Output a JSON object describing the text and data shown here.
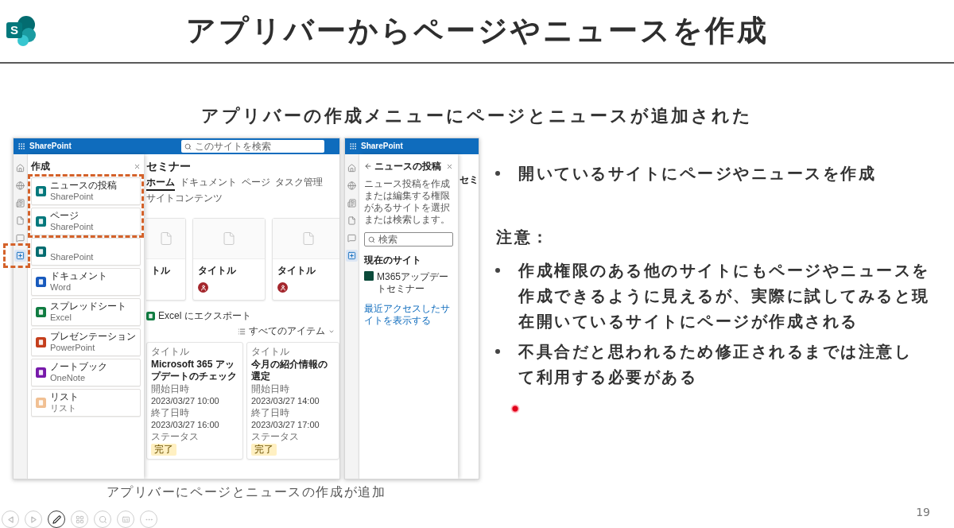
{
  "logo": {
    "letter": "S"
  },
  "title": "アプリバーからページやニュースを作成",
  "subtitle": "アプリバーの作成メニューにページとニュースが追加された",
  "screenshot_main": {
    "app_name": "SharePoint",
    "search_placeholder": "このサイトを検索",
    "rail": [
      {
        "kind": "home",
        "selected": false
      },
      {
        "kind": "sites",
        "selected": false
      },
      {
        "kind": "news",
        "selected": false
      },
      {
        "kind": "files",
        "selected": false
      },
      {
        "kind": "chat",
        "selected": false
      },
      {
        "kind": "create",
        "selected": true
      }
    ],
    "create_panel": {
      "title": "作成",
      "items": [
        {
          "kind": "news",
          "title": "ニュースの投稿",
          "subtitle": "SharePoint"
        },
        {
          "kind": "page",
          "title": "ページ",
          "subtitle": "SharePoint"
        },
        {
          "kind": "site",
          "subtitle": "SharePoint"
        },
        {
          "kind": "word",
          "title": "ドキュメント",
          "subtitle": "Word"
        },
        {
          "kind": "excel",
          "title": "スプレッドシート",
          "subtitle": "Excel"
        },
        {
          "kind": "powerpoint",
          "title": "プレゼンテーション",
          "subtitle": "PowerPoint"
        },
        {
          "kind": "onenote",
          "title": "ノートブック",
          "subtitle": "OneNote"
        },
        {
          "kind": "list",
          "title": "リスト",
          "subtitle": "リスト"
        }
      ]
    },
    "site_title": "セミナー",
    "nav": [
      {
        "label": "ホーム",
        "selected": true
      },
      {
        "label": "ドキュメント",
        "selected": false
      },
      {
        "label": "ページ",
        "selected": false
      },
      {
        "label": "タスク管理",
        "selected": false
      },
      {
        "label": "サイトコンテンツ",
        "selected": false
      }
    ],
    "cards": [
      {
        "kind": "clipped",
        "title": "トル"
      },
      {
        "kind": "full",
        "title": "タイトル"
      },
      {
        "kind": "full",
        "title": "タイトル"
      }
    ],
    "list_toolbar": {
      "export": "Excel にエクスポート",
      "view": "すべてのアイテム"
    },
    "list_items": [
      {
        "label": "タイトル",
        "title": "Microsoft 365 アップデートのチェック",
        "start_label": "開始日時",
        "start": "2023/03/27 10:00",
        "end_label": "終了日時",
        "end": "2023/03/27 16:00",
        "status_label": "ステータス",
        "status": "完了"
      },
      {
        "label": "タイトル",
        "title": "今月の紹介情報の選定",
        "start_label": "開始日時",
        "start": "2023/03/27 14:00",
        "end_label": "終了日時",
        "end": "2023/03/27 17:00",
        "status_label": "ステータス",
        "status": "完了"
      }
    ]
  },
  "screenshot_news": {
    "app_name": "SharePoint",
    "rail": [
      {
        "kind": "home",
        "selected": false
      },
      {
        "kind": "sites",
        "selected": false
      },
      {
        "kind": "news",
        "selected": false
      },
      {
        "kind": "files",
        "selected": false
      },
      {
        "kind": "chat",
        "selected": false
      },
      {
        "kind": "create",
        "selected": true
      }
    ],
    "panel": {
      "title": "ニュースの投稿",
      "description": "ニュース投稿を作成または編集する権限があるサイトを選択または検索します。",
      "search_placeholder": "検索",
      "section": "現在のサイト",
      "site": "M365アップデートセミナー",
      "link": "最近アクセスしたサイトを表示する"
    },
    "background_title": "セミ"
  },
  "caption": "アプリバーにページとニュースの作成が追加",
  "bullets": [
    "開いているサイトにページやニュースを作成"
  ],
  "note_heading": "注意：",
  "notes": [
    "作成権限のある他のサイトにもページやニュースを作成できるように見えるが、実際に試してみると現在開いているサイトにページが作成される",
    "不具合だと思われるため修正されるまでは注意して利用する必要がある"
  ],
  "page_number": "19",
  "presenter_tools": [
    {
      "kind": "previous",
      "selected": false
    },
    {
      "kind": "next",
      "selected": false
    },
    {
      "kind": "pen",
      "selected": true
    },
    {
      "kind": "slides",
      "selected": false
    },
    {
      "kind": "zoom",
      "selected": false
    },
    {
      "kind": "subtitles",
      "selected": false
    },
    {
      "kind": "more",
      "selected": false
    }
  ]
}
